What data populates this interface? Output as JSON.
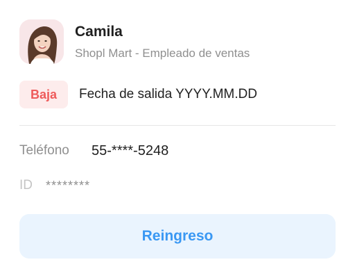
{
  "profile": {
    "name": "Camila",
    "subtitle": "Shopl Mart - Empleado de ventas",
    "avatar_icon": "person-photo"
  },
  "status": {
    "badge": "Baja",
    "exit_date": "Fecha de salida YYYY.MM.DD",
    "badge_color": "#ee5a5a",
    "badge_bg": "#fdecec"
  },
  "fields": {
    "phone_label": "Teléfono",
    "phone_value": "55-****-5248",
    "id_label": "ID",
    "id_value": "********"
  },
  "actions": {
    "rejoin_label": "Reingreso",
    "accent_color": "#3a98f3"
  }
}
